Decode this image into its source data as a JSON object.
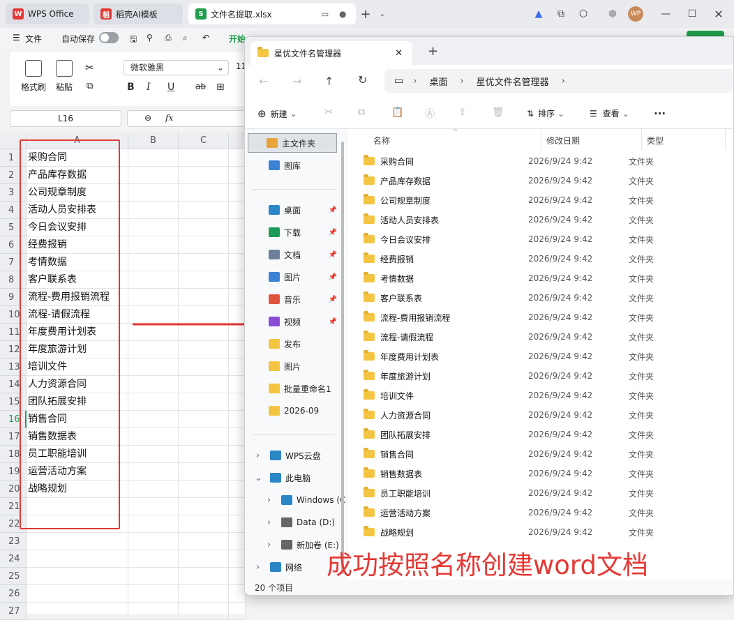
{
  "wps_tabs": {
    "wps": "WPS Office",
    "daoke": "稻壳AI模板",
    "file": "文件名提取.xlsx"
  },
  "avatar": "WP",
  "menu": {
    "file": "文件",
    "autosave": "自动保存",
    "start": "开始"
  },
  "ribbon": {
    "format_painter": "格式刷",
    "paste": "粘贴",
    "font": "微软雅黑",
    "font_size": "11"
  },
  "namebox": "L16",
  "fx": "fx",
  "columns": [
    "A",
    "B",
    "C"
  ],
  "rows": [
    "1",
    "2",
    "3",
    "4",
    "5",
    "6",
    "7",
    "8",
    "9",
    "10",
    "11",
    "12",
    "13",
    "14",
    "15",
    "16",
    "17",
    "18",
    "19",
    "20",
    "21",
    "22",
    "23",
    "24",
    "25",
    "26",
    "27"
  ],
  "cells_a": [
    "采购合同",
    "产品库存数据",
    "公司规章制度",
    "活动人员安排表",
    "今日会议安排",
    "经费报销",
    "考情数据",
    "客户联系表",
    "流程-费用报销流程",
    "流程-请假流程",
    "年度费用计划表",
    "年度旅游计划",
    "培训文件",
    "人力资源合同",
    "团队拓展安排",
    "销售合同",
    "销售数据表",
    "员工职能培训",
    "运营活动方案",
    "战略规划"
  ],
  "explorer": {
    "tab_title": "星优文件名管理器",
    "breadcrumb": [
      "桌面",
      "星优文件名管理器"
    ],
    "toolbar": {
      "new": "新建",
      "sort": "排序",
      "view": "查看",
      "more": "···"
    },
    "nav": [
      {
        "label": "主文件夹",
        "icon": "home-icon"
      },
      {
        "label": "图库",
        "icon": "gallery-icon"
      },
      {
        "label": "桌面",
        "icon": "desktop-icon",
        "pinned": true
      },
      {
        "label": "下载",
        "icon": "download-icon",
        "pinned": true
      },
      {
        "label": "文档",
        "icon": "document-icon",
        "pinned": true
      },
      {
        "label": "图片",
        "icon": "picture-icon",
        "pinned": true
      },
      {
        "label": "音乐",
        "icon": "music-icon",
        "pinned": true
      },
      {
        "label": "视频",
        "icon": "video-icon",
        "pinned": true
      },
      {
        "label": "发布",
        "icon": "folder-icon"
      },
      {
        "label": "图片",
        "icon": "folder-icon"
      },
      {
        "label": "批量重命名1",
        "icon": "folder-icon"
      },
      {
        "label": "2026-09",
        "icon": "folder-icon"
      },
      {
        "label": "WPS云盘",
        "icon": "cloud-icon"
      },
      {
        "label": "此电脑",
        "icon": "pc-icon"
      },
      {
        "label": "Windows (C",
        "icon": "windows-drive-icon"
      },
      {
        "label": "Data (D:)",
        "icon": "drive-icon"
      },
      {
        "label": "新加卷 (E:)",
        "icon": "drive-icon"
      },
      {
        "label": "网络",
        "icon": "network-icon"
      }
    ],
    "headers": {
      "name": "名称",
      "date": "修改日期",
      "type": "类型"
    },
    "files": [
      "采购合同",
      "产品库存数据",
      "公司规章制度",
      "活动人员安排表",
      "今日会议安排",
      "经费报销",
      "考情数据",
      "客户联系表",
      "流程-费用报销流程",
      "流程-请假流程",
      "年度费用计划表",
      "年度旅游计划",
      "培训文件",
      "人力资源合同",
      "团队拓展安排",
      "销售合同",
      "销售数据表",
      "员工职能培训",
      "运营活动方案",
      "战略规划"
    ],
    "file_date": "2026/9/24 9:42",
    "file_type": "文件夹",
    "status": "20 个项目"
  },
  "caption": "成功按照名称创建word文档",
  "colors": {
    "accent_red": "#e53935",
    "folder": "#f4c542",
    "wps_green": "#1f9e4b"
  }
}
